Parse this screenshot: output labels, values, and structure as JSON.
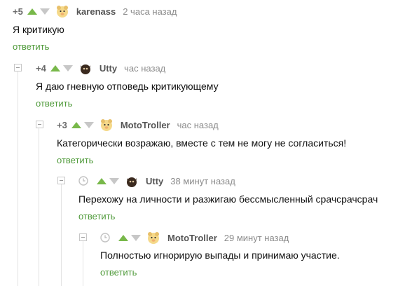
{
  "colors": {
    "upvote": "#78b84a",
    "downvote": "#c7c7c7",
    "reply": "#4f9a3a",
    "rail": "#e3e3e3"
  },
  "comments": [
    {
      "score": "+5",
      "author": "karenass",
      "time": "2 часа назад",
      "text": "Я критикую",
      "reply": "ответить",
      "avatar": "hamster-avatar-icon"
    },
    {
      "score": "+4",
      "author": "Utty",
      "time": "час назад",
      "text": "Я даю гневную отповедь критикующему",
      "reply": "ответить",
      "avatar": "dark-creature-avatar-icon"
    },
    {
      "score": "+3",
      "author": "MotoTroller",
      "time": "час назад",
      "text": "Категорически возражаю, вместе с тем не могу не согласиться!",
      "reply": "ответить",
      "avatar": "hamster-avatar-icon"
    },
    {
      "author": "Utty",
      "time": "38 минут назад",
      "text": "Перехожу на личности и разжигаю бессмысленный срачсрачсрач",
      "reply": "ответить",
      "avatar": "dark-creature-avatar-icon",
      "icon": "clock-icon"
    },
    {
      "author": "MotoTroller",
      "time": "29 минут назад",
      "text": "Полностью игнорирую выпады и принимаю участие.",
      "reply": "ответить",
      "avatar": "hamster-avatar-icon",
      "icon": "clock-icon"
    }
  ]
}
